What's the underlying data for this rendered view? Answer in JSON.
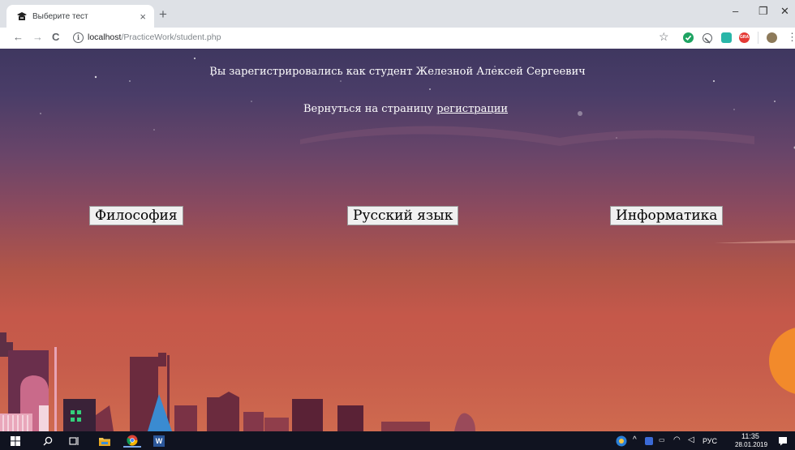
{
  "browser": {
    "tab_title": "Выберите тест",
    "tab_close": "×",
    "new_tab": "+",
    "url_host": "localhost",
    "url_path": "/PracticeWork/student.php",
    "back": "←",
    "forward": "→",
    "reload": "C",
    "info": "i",
    "star": "☆",
    "menu": "⋮",
    "minimize": "–",
    "restore": "❐",
    "close": "✕",
    "ext_badge": "GRA"
  },
  "page": {
    "registered_text": "Вы зарегистрировались как студент Железной Алексей Сергеевич",
    "back_text": "Вернуться на страницу ",
    "back_link": "регистрации",
    "subjects": [
      "Философия",
      "Русский язык",
      "Информатика"
    ]
  },
  "taskbar": {
    "time": "11:35",
    "date": "28.01.2019",
    "lang": "РУС",
    "word_label": "W"
  },
  "colors": {
    "accent_green": "#1ea362",
    "browser_bg": "#dee1e6"
  }
}
